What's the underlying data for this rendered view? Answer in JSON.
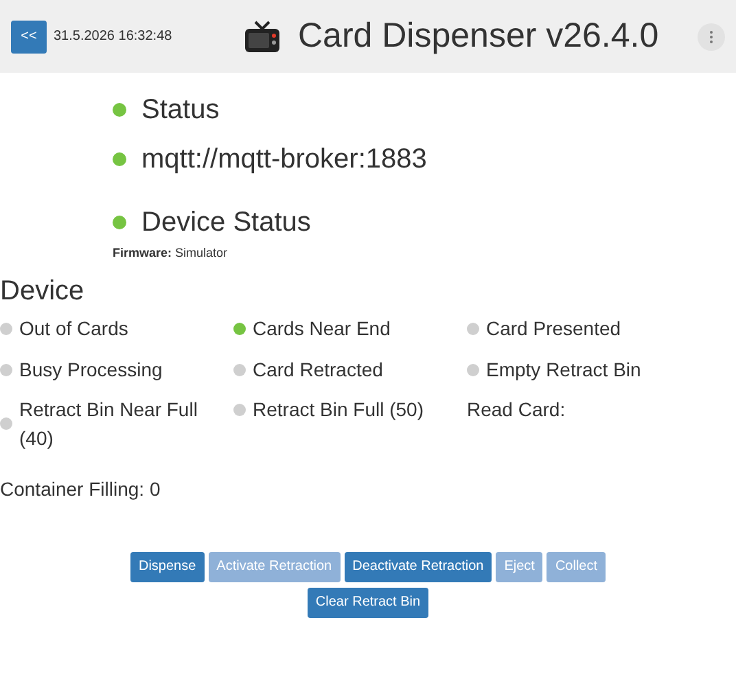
{
  "header": {
    "back_button": "<<",
    "datetime": "31.5.2026 16:32:48",
    "title": "Card Dispenser v26.4.0"
  },
  "connection": [
    {
      "label": "Status",
      "on": true
    },
    {
      "label": "mqtt://mqtt-broker:1883",
      "on": true
    }
  ],
  "device_status": {
    "label": "Device Status",
    "on": true,
    "firmware_label": "Firmware:",
    "firmware_value": "Simulator"
  },
  "device": {
    "heading": "Device",
    "items": [
      {
        "kind": "indicator",
        "label": "Out of Cards",
        "on": false
      },
      {
        "kind": "indicator",
        "label": "Cards Near End",
        "on": true
      },
      {
        "kind": "indicator",
        "label": "Card Presented",
        "on": false
      },
      {
        "kind": "indicator",
        "label": "Busy Processing",
        "on": false
      },
      {
        "kind": "indicator",
        "label": "Card Retracted",
        "on": false
      },
      {
        "kind": "indicator",
        "label": "Empty Retract Bin",
        "on": false
      },
      {
        "kind": "indicator",
        "label": "Retract Bin Near Full (40)",
        "on": false
      },
      {
        "kind": "indicator",
        "label": "Retract Bin Full (50)",
        "on": false
      },
      {
        "kind": "text",
        "label": "Read Card:"
      }
    ],
    "container_filling": "Container Filling: 0"
  },
  "buttons": [
    {
      "label": "Dispense",
      "disabled": false
    },
    {
      "label": "Activate Retraction",
      "disabled": true
    },
    {
      "label": "Deactivate Retraction",
      "disabled": false
    },
    {
      "label": "Eject",
      "disabled": true
    },
    {
      "label": "Collect",
      "disabled": true
    },
    {
      "label": "Clear Retract Bin",
      "disabled": false
    }
  ]
}
